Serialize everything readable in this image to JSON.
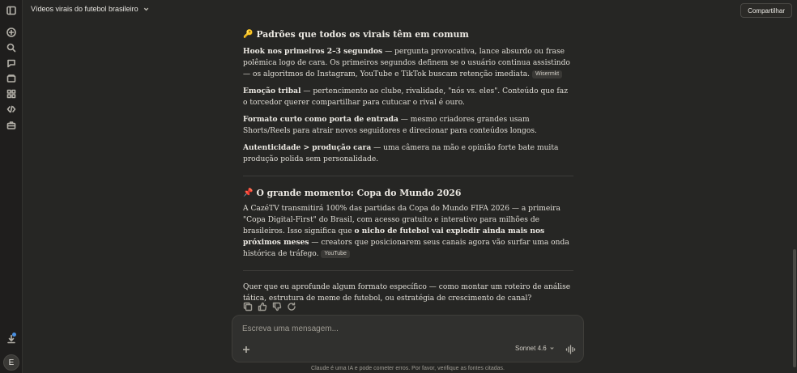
{
  "header": {
    "title": "Vídeos virais do futebol brasileiro",
    "share_label": "Compartilhar"
  },
  "sidebar": {
    "avatar_initial": "E"
  },
  "section1": {
    "emoji": "🔑",
    "heading": "Padrões que todos os virais têm em comum",
    "p1_bold": "Hook nos primeiros 2–3 segundos",
    "p1_text": " — pergunta provocativa, lance absurdo ou frase polêmica logo de cara. Os primeiros segundos definem se o usuário continua assistindo — os algoritmos do Instagram, YouTube e TikTok buscam retenção imediata.",
    "p1_cite": "Wisermkt",
    "p2_bold": "Emoção tribal",
    "p2_text": " — pertencimento ao clube, rivalidade, \"nós vs. eles\". Conteúdo que faz o torcedor querer compartilhar para cutucar o rival é ouro.",
    "p3_bold": "Formato curto como porta de entrada",
    "p3_text": " — mesmo criadores grandes usam Shorts/Reels para atrair novos seguidores e direcionar para conteúdos longos.",
    "p4_bold": "Autenticidade > produção cara",
    "p4_text": " — uma câmera na mão e opinião forte bate muita produção polida sem personalidade."
  },
  "section2": {
    "emoji": "📌",
    "heading": "O grande momento: Copa do Mundo 2026",
    "p1_text_a": "A CazéTV transmitirá 100% das partidas da Copa do Mundo FIFA 2026 — a primeira \"Copa Digital-First\" do Brasil, com acesso gratuito e interativo para milhões de brasileiros. Isso significa que ",
    "p1_bold": "o nicho de futebol vai explodir ainda mais nos próximos meses",
    "p1_text_b": " — creators que posicionarem seus canais agora vão surfar uma onda histórica de tráfego.",
    "p1_cite": "YouTube"
  },
  "closing": {
    "text": "Quer que eu aprofunde algum formato específico — como montar um roteiro de análise tática, estrutura de meme de futebol, ou estratégia de crescimento de canal?"
  },
  "composer": {
    "placeholder": "Escreva uma mensagem...",
    "model": "Sonnet 4.6"
  },
  "footer": {
    "disclaimer": "Claude é uma IA e pode cometer erros. Por favor, verifique as fontes citadas."
  }
}
